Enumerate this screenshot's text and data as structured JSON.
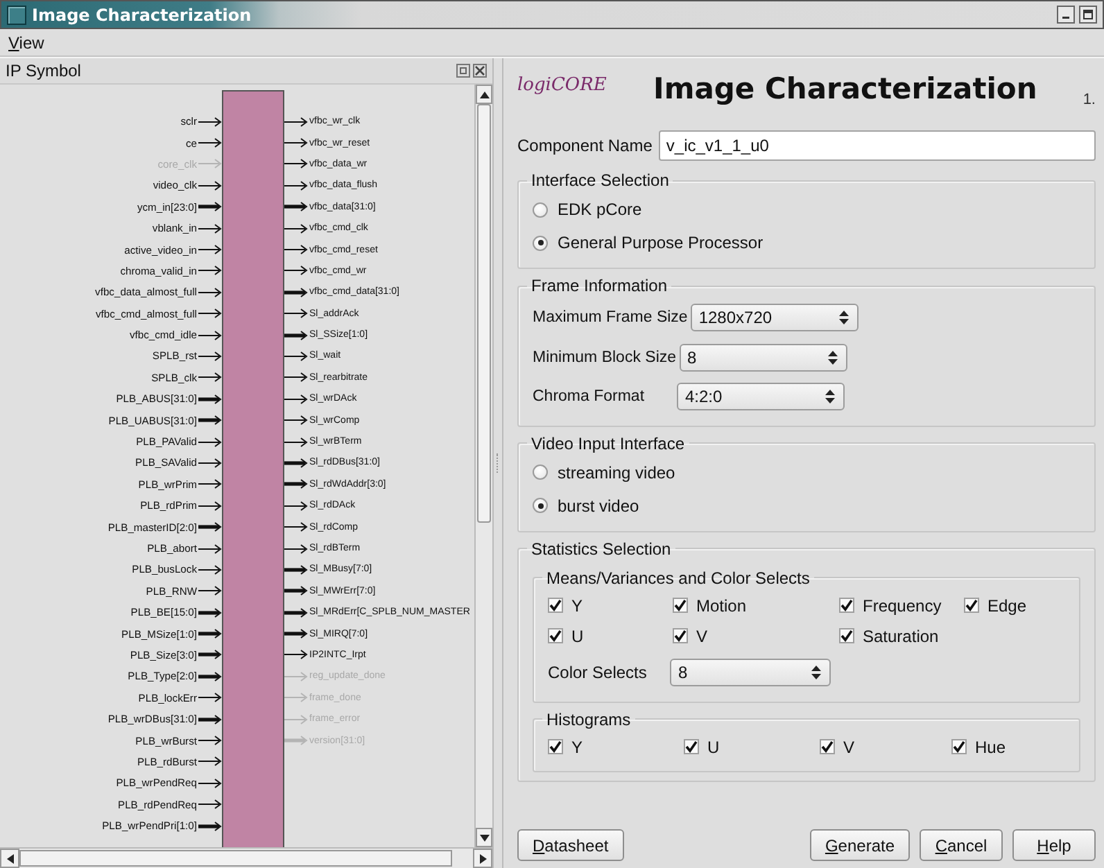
{
  "window": {
    "title": "Image Characterization"
  },
  "menu": [
    {
      "label": "View"
    }
  ],
  "ip_symbol": {
    "title": "IP Symbol",
    "inputs": [
      {
        "name": "sclr",
        "bus": false,
        "disabled": false
      },
      {
        "name": "ce",
        "bus": false,
        "disabled": false
      },
      {
        "name": "core_clk",
        "bus": false,
        "disabled": true
      },
      {
        "name": "video_clk",
        "bus": false,
        "disabled": false
      },
      {
        "name": "ycm_in[23:0]",
        "bus": true,
        "disabled": false
      },
      {
        "name": "vblank_in",
        "bus": false,
        "disabled": false
      },
      {
        "name": "active_video_in",
        "bus": false,
        "disabled": false
      },
      {
        "name": "chroma_valid_in",
        "bus": false,
        "disabled": false
      },
      {
        "name": "vfbc_data_almost_full",
        "bus": false,
        "disabled": false
      },
      {
        "name": "vfbc_cmd_almost_full",
        "bus": false,
        "disabled": false
      },
      {
        "name": "vfbc_cmd_idle",
        "bus": false,
        "disabled": false
      },
      {
        "name": "SPLB_rst",
        "bus": false,
        "disabled": false
      },
      {
        "name": "SPLB_clk",
        "bus": false,
        "disabled": false
      },
      {
        "name": "PLB_ABUS[31:0]",
        "bus": true,
        "disabled": false
      },
      {
        "name": "PLB_UABUS[31:0]",
        "bus": true,
        "disabled": false
      },
      {
        "name": "PLB_PAValid",
        "bus": false,
        "disabled": false
      },
      {
        "name": "PLB_SAValid",
        "bus": false,
        "disabled": false
      },
      {
        "name": "PLB_wrPrim",
        "bus": false,
        "disabled": false
      },
      {
        "name": "PLB_rdPrim",
        "bus": false,
        "disabled": false
      },
      {
        "name": "PLB_masterID[2:0]",
        "bus": true,
        "disabled": false
      },
      {
        "name": "PLB_abort",
        "bus": false,
        "disabled": false
      },
      {
        "name": "PLB_busLock",
        "bus": false,
        "disabled": false
      },
      {
        "name": "PLB_RNW",
        "bus": false,
        "disabled": false
      },
      {
        "name": "PLB_BE[15:0]",
        "bus": true,
        "disabled": false
      },
      {
        "name": "PLB_MSize[1:0]",
        "bus": true,
        "disabled": false
      },
      {
        "name": "PLB_Size[3:0]",
        "bus": true,
        "disabled": false
      },
      {
        "name": "PLB_Type[2:0]",
        "bus": true,
        "disabled": false
      },
      {
        "name": "PLB_lockErr",
        "bus": false,
        "disabled": false
      },
      {
        "name": "PLB_wrDBus[31:0]",
        "bus": true,
        "disabled": false
      },
      {
        "name": "PLB_wrBurst",
        "bus": false,
        "disabled": false
      },
      {
        "name": "PLB_rdBurst",
        "bus": false,
        "disabled": false
      },
      {
        "name": "PLB_wrPendReq",
        "bus": false,
        "disabled": false
      },
      {
        "name": "PLB_rdPendReq",
        "bus": false,
        "disabled": false
      },
      {
        "name": "PLB_wrPendPri[1:0]",
        "bus": true,
        "disabled": false
      }
    ],
    "outputs": [
      {
        "name": "vfbc_wr_clk",
        "bus": false,
        "disabled": false
      },
      {
        "name": "vfbc_wr_reset",
        "bus": false,
        "disabled": false
      },
      {
        "name": "vfbc_data_wr",
        "bus": false,
        "disabled": false
      },
      {
        "name": "vfbc_data_flush",
        "bus": false,
        "disabled": false
      },
      {
        "name": "vfbc_data[31:0]",
        "bus": true,
        "disabled": false
      },
      {
        "name": "vfbc_cmd_clk",
        "bus": false,
        "disabled": false
      },
      {
        "name": "vfbc_cmd_reset",
        "bus": false,
        "disabled": false
      },
      {
        "name": "vfbc_cmd_wr",
        "bus": false,
        "disabled": false
      },
      {
        "name": "vfbc_cmd_data[31:0]",
        "bus": true,
        "disabled": false
      },
      {
        "name": "Sl_addrAck",
        "bus": false,
        "disabled": false
      },
      {
        "name": "Sl_SSize[1:0]",
        "bus": true,
        "disabled": false
      },
      {
        "name": "Sl_wait",
        "bus": false,
        "disabled": false
      },
      {
        "name": "Sl_rearbitrate",
        "bus": false,
        "disabled": false
      },
      {
        "name": "Sl_wrDAck",
        "bus": false,
        "disabled": false
      },
      {
        "name": "Sl_wrComp",
        "bus": false,
        "disabled": false
      },
      {
        "name": "Sl_wrBTerm",
        "bus": false,
        "disabled": false
      },
      {
        "name": "Sl_rdDBus[31:0]",
        "bus": true,
        "disabled": false
      },
      {
        "name": "Sl_rdWdAddr[3:0]",
        "bus": true,
        "disabled": false
      },
      {
        "name": "Sl_rdDAck",
        "bus": false,
        "disabled": false
      },
      {
        "name": "Sl_rdComp",
        "bus": false,
        "disabled": false
      },
      {
        "name": "Sl_rdBTerm",
        "bus": false,
        "disabled": false
      },
      {
        "name": "Sl_MBusy[7:0]",
        "bus": true,
        "disabled": false
      },
      {
        "name": "Sl_MWrErr[7:0]",
        "bus": true,
        "disabled": false
      },
      {
        "name": "Sl_MRdErr[C_SPLB_NUM_MASTER",
        "bus": true,
        "disabled": false
      },
      {
        "name": "Sl_MIRQ[7:0]",
        "bus": true,
        "disabled": false
      },
      {
        "name": "IP2INTC_Irpt",
        "bus": false,
        "disabled": false
      },
      {
        "name": "reg_update_done",
        "bus": false,
        "disabled": true
      },
      {
        "name": "frame_done",
        "bus": false,
        "disabled": true
      },
      {
        "name": "frame_error",
        "bus": false,
        "disabled": true
      },
      {
        "name": "version[31:0]",
        "bus": true,
        "disabled": true
      }
    ]
  },
  "config": {
    "logo": "logiCORE",
    "title": "Image Characterization",
    "version": "1.",
    "component_name": {
      "label": "Component Name",
      "value": "v_ic_v1_1_u0"
    },
    "interface_selection": {
      "title": "Interface Selection",
      "options": [
        {
          "label": "EDK pCore",
          "selected": false
        },
        {
          "label": "General Purpose Processor",
          "selected": true
        }
      ]
    },
    "frame_information": {
      "title": "Frame Information",
      "fields": [
        {
          "label": "Maximum Frame Size",
          "value": "1280x720"
        },
        {
          "label": "Minimum Block Size",
          "value": "8"
        },
        {
          "label": "Chroma Format",
          "value": "4:2:0"
        }
      ]
    },
    "video_input": {
      "title": "Video Input Interface",
      "options": [
        {
          "label": "streaming video",
          "selected": false
        },
        {
          "label": "burst video",
          "selected": true
        }
      ]
    },
    "statistics": {
      "title": "Statistics Selection",
      "means": {
        "title": "Means/Variances and Color Selects",
        "checks": [
          {
            "label": "Y",
            "checked": true
          },
          {
            "label": "Motion",
            "checked": true
          },
          {
            "label": "Frequency",
            "checked": true
          },
          {
            "label": "Edge",
            "checked": true
          },
          {
            "label": "U",
            "checked": true
          },
          {
            "label": "V",
            "checked": true
          },
          {
            "label": "Saturation",
            "checked": true
          }
        ],
        "color_selects": {
          "label": "Color Selects",
          "value": "8"
        }
      },
      "histograms": {
        "title": "Histograms",
        "checks": [
          {
            "label": "Y",
            "checked": true
          },
          {
            "label": "U",
            "checked": true
          },
          {
            "label": "V",
            "checked": true
          },
          {
            "label": "Hue",
            "checked": true
          }
        ]
      }
    }
  },
  "buttons": [
    {
      "label": "Datasheet",
      "kind": "left"
    },
    {
      "label": "Generate",
      "kind": "right"
    },
    {
      "label": "Cancel",
      "kind": "right"
    },
    {
      "label": "Help",
      "kind": "right"
    }
  ]
}
